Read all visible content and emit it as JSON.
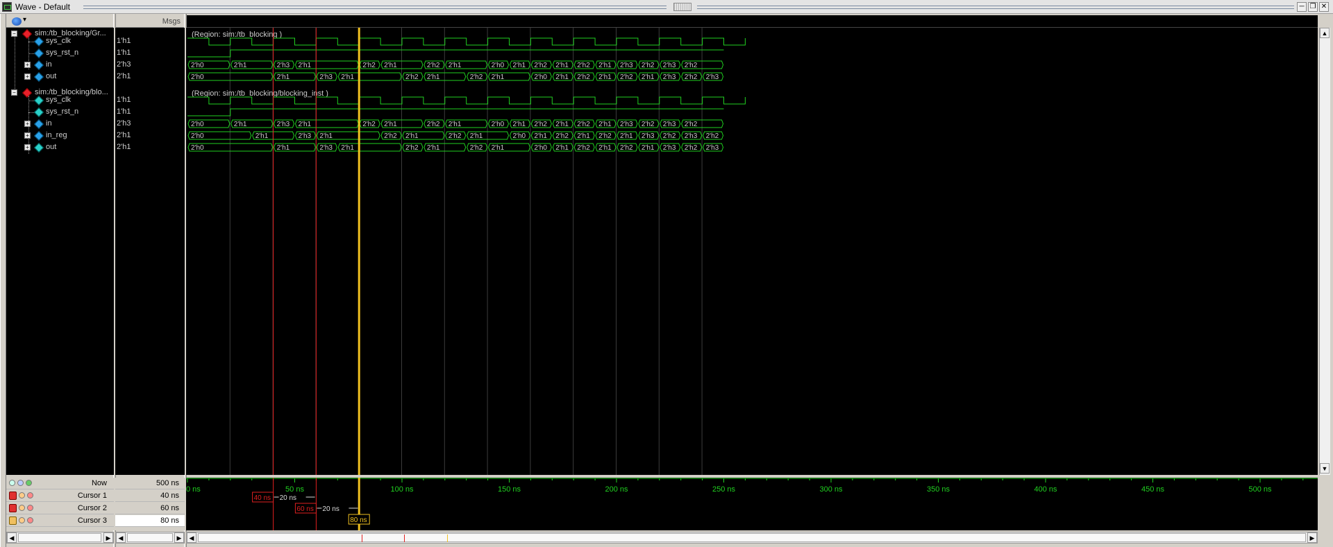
{
  "window": {
    "title": "Wave - Default",
    "buttons": [
      "─",
      "❐",
      "✕"
    ]
  },
  "header": {
    "values_title": "Msgs"
  },
  "groups": [
    {
      "name": "sim:/tb_blocking/Gr...",
      "region": "(Region: sim:/tb_blocking )",
      "signals": [
        {
          "name": "sys_clk",
          "value": "1'h1",
          "kind": "clock",
          "expandable": false,
          "icon": "blue"
        },
        {
          "name": "sys_rst_n",
          "value": "1'h1",
          "kind": "reset",
          "expandable": false,
          "icon": "blue"
        },
        {
          "name": "in",
          "value": "2'h3",
          "kind": "bus",
          "expandable": true,
          "icon": "blue",
          "transitions_ns": [
            0,
            20,
            40,
            50,
            80,
            90,
            100,
            110,
            120,
            130,
            140,
            150,
            160,
            170,
            180,
            190,
            200,
            210,
            220,
            230,
            240,
            250
          ],
          "values": [
            "2'h0",
            "2'h1",
            "2'h3",
            "2'h1",
            "2'h2",
            "2'h1",
            "2'h2",
            "2'h1",
            "2'h0",
            "2'h1",
            "2'h2",
            "2'h1",
            "2'h2",
            "2'h1",
            "2'h3",
            "2'h2",
            "2'h3",
            "2'h2"
          ],
          "segments": [
            [
              0,
              20,
              "2'h0"
            ],
            [
              20,
              40,
              "2'h1"
            ],
            [
              40,
              50,
              "2'h3"
            ],
            [
              50,
              80,
              "2'h1"
            ],
            [
              80,
              90,
              "2'h2"
            ],
            [
              90,
              110,
              "2'h1"
            ],
            [
              110,
              120,
              "2'h2"
            ],
            [
              120,
              140,
              "2'h1"
            ],
            [
              140,
              150,
              "2'h0"
            ],
            [
              150,
              160,
              "2'h1"
            ],
            [
              160,
              170,
              "2'h2"
            ],
            [
              170,
              180,
              "2'h1"
            ],
            [
              180,
              190,
              "2'h2"
            ],
            [
              190,
              200,
              "2'h1"
            ],
            [
              200,
              210,
              "2'h3"
            ],
            [
              210,
              220,
              "2'h2"
            ],
            [
              220,
              230,
              "2'h3"
            ],
            [
              230,
              250,
              "2'h2"
            ]
          ]
        },
        {
          "name": "out",
          "value": "2'h1",
          "kind": "bus",
          "expandable": true,
          "icon": "blue",
          "segments": [
            [
              0,
              40,
              "2'h0"
            ],
            [
              40,
              60,
              "2'h1"
            ],
            [
              60,
              70,
              "2'h3"
            ],
            [
              70,
              100,
              "2'h1"
            ],
            [
              100,
              110,
              "2'h2"
            ],
            [
              110,
              130,
              "2'h1"
            ],
            [
              130,
              140,
              "2'h2"
            ],
            [
              140,
              160,
              "2'h1"
            ],
            [
              160,
              170,
              "2'h0"
            ],
            [
              170,
              180,
              "2'h1"
            ],
            [
              180,
              190,
              "2'h2"
            ],
            [
              190,
              200,
              "2'h1"
            ],
            [
              200,
              210,
              "2'h2"
            ],
            [
              210,
              220,
              "2'h1"
            ],
            [
              220,
              230,
              "2'h3"
            ],
            [
              230,
              240,
              "2'h2"
            ],
            [
              240,
              250,
              "2'h3"
            ]
          ]
        }
      ]
    },
    {
      "name": "sim:/tb_blocking/blo...",
      "region": "(Region: sim:/tb_blocking/blocking_inst )",
      "signals": [
        {
          "name": "sys_clk",
          "value": "1'h1",
          "kind": "clock",
          "expandable": false,
          "icon": "teal"
        },
        {
          "name": "sys_rst_n",
          "value": "1'h1",
          "kind": "reset",
          "expandable": false,
          "icon": "teal"
        },
        {
          "name": "in",
          "value": "2'h3",
          "kind": "bus",
          "expandable": true,
          "icon": "blue",
          "segments": [
            [
              0,
              20,
              "2'h0"
            ],
            [
              20,
              40,
              "2'h1"
            ],
            [
              40,
              50,
              "2'h3"
            ],
            [
              50,
              80,
              "2'h1"
            ],
            [
              80,
              90,
              "2'h2"
            ],
            [
              90,
              110,
              "2'h1"
            ],
            [
              110,
              120,
              "2'h2"
            ],
            [
              120,
              140,
              "2'h1"
            ],
            [
              140,
              150,
              "2'h0"
            ],
            [
              150,
              160,
              "2'h1"
            ],
            [
              160,
              170,
              "2'h2"
            ],
            [
              170,
              180,
              "2'h1"
            ],
            [
              180,
              190,
              "2'h2"
            ],
            [
              190,
              200,
              "2'h1"
            ],
            [
              200,
              210,
              "2'h3"
            ],
            [
              210,
              220,
              "2'h2"
            ],
            [
              220,
              230,
              "2'h3"
            ],
            [
              230,
              250,
              "2'h2"
            ]
          ]
        },
        {
          "name": "in_reg",
          "value": "2'h1",
          "kind": "bus",
          "expandable": true,
          "icon": "blue",
          "segments": [
            [
              0,
              30,
              "2'h0"
            ],
            [
              30,
              50,
              "2'h1"
            ],
            [
              50,
              60,
              "2'h3"
            ],
            [
              60,
              90,
              "2'h1"
            ],
            [
              90,
              100,
              "2'h2"
            ],
            [
              100,
              120,
              "2'h1"
            ],
            [
              120,
              130,
              "2'h2"
            ],
            [
              130,
              150,
              "2'h1"
            ],
            [
              150,
              160,
              "2'h0"
            ],
            [
              160,
              170,
              "2'h1"
            ],
            [
              170,
              180,
              "2'h2"
            ],
            [
              180,
              190,
              "2'h1"
            ],
            [
              190,
              200,
              "2'h2"
            ],
            [
              200,
              210,
              "2'h1"
            ],
            [
              210,
              220,
              "2'h3"
            ],
            [
              220,
              230,
              "2'h2"
            ],
            [
              230,
              240,
              "2'h3"
            ],
            [
              240,
              250,
              "2'h2"
            ]
          ]
        },
        {
          "name": "out",
          "value": "2'h1",
          "kind": "bus",
          "expandable": true,
          "icon": "teal",
          "segments": [
            [
              0,
              40,
              "2'h0"
            ],
            [
              40,
              60,
              "2'h1"
            ],
            [
              60,
              70,
              "2'h3"
            ],
            [
              70,
              100,
              "2'h1"
            ],
            [
              100,
              110,
              "2'h2"
            ],
            [
              110,
              130,
              "2'h1"
            ],
            [
              130,
              140,
              "2'h2"
            ],
            [
              140,
              160,
              "2'h1"
            ],
            [
              160,
              170,
              "2'h0"
            ],
            [
              170,
              180,
              "2'h1"
            ],
            [
              180,
              190,
              "2'h2"
            ],
            [
              190,
              200,
              "2'h1"
            ],
            [
              200,
              210,
              "2'h2"
            ],
            [
              210,
              220,
              "2'h1"
            ],
            [
              220,
              230,
              "2'h3"
            ],
            [
              230,
              240,
              "2'h2"
            ],
            [
              240,
              250,
              "2'h3"
            ]
          ]
        }
      ]
    }
  ],
  "timeline": {
    "now_label": "Now",
    "now_value": "500 ns",
    "ticks": [
      "0 ns",
      "50 ns",
      "100 ns",
      "150 ns",
      "200 ns",
      "250 ns",
      "300 ns",
      "350 ns",
      "400 ns",
      "450 ns",
      "500 ns"
    ],
    "tick_values_ns": [
      0,
      50,
      100,
      150,
      200,
      250,
      300,
      350,
      400,
      450,
      500
    ],
    "clock_period_ns": 20,
    "reset_release_ns": 10,
    "sim_end_ns": 250
  },
  "cursors": [
    {
      "label": "Cursor 1",
      "value": "40 ns",
      "time_ns": 40,
      "delta": "20 ns",
      "color": "#e02020",
      "locked": true
    },
    {
      "label": "Cursor 2",
      "value": "60 ns",
      "time_ns": 60,
      "delta": "20 ns",
      "color": "#e02020",
      "locked": true
    },
    {
      "label": "Cursor 3",
      "value": "80 ns",
      "time_ns": 80,
      "color": "#f0c020",
      "locked": false,
      "active": true
    }
  ],
  "colors": {
    "wave": "#20d020",
    "background": "#000000",
    "grid": "#3c3c3c",
    "text": "#cccccc"
  }
}
